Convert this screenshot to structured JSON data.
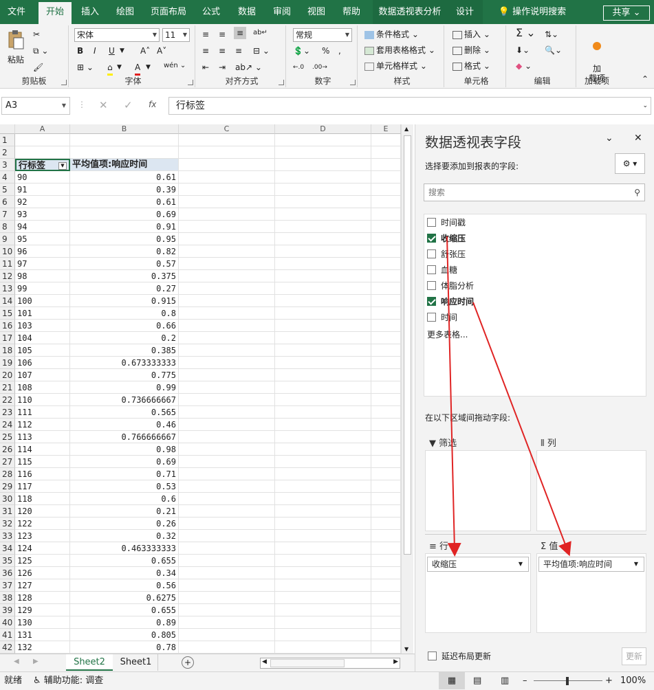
{
  "tabs": [
    "文件",
    "开始",
    "插入",
    "绘图",
    "页面布局",
    "公式",
    "数据",
    "审阅",
    "视图",
    "帮助",
    "数据透视表分析",
    "设计"
  ],
  "tell_me": "操作说明搜索",
  "share": "共享",
  "ribbon": {
    "clipboard": {
      "paste": "粘贴",
      "label": "剪贴板"
    },
    "font": {
      "name": "宋体",
      "size": "11",
      "label": "字体",
      "bold": "B",
      "italic": "I",
      "underline": "U"
    },
    "align": {
      "label": "对齐方式"
    },
    "number": {
      "format": "常规",
      "label": "数字",
      "percent": "%"
    },
    "styles": {
      "cond": "条件格式",
      "table": "套用表格格式",
      "cell": "单元格样式",
      "label": "样式"
    },
    "cells": {
      "insert": "插入",
      "delete": "删除",
      "format": "格式",
      "label": "单元格"
    },
    "editing": {
      "label": "编辑"
    },
    "addins": {
      "btn": "加\n载项",
      "label": "加载项"
    }
  },
  "formula": {
    "namebox": "A3",
    "fx": "fx",
    "content": "行标签"
  },
  "columns": [
    "A",
    "B",
    "C",
    "D",
    "E"
  ],
  "pivot": {
    "header_a": "行标签",
    "header_b": "平均值项:响应时间",
    "rows": [
      [
        "90",
        "0.61"
      ],
      [
        "91",
        "0.39"
      ],
      [
        "92",
        "0.61"
      ],
      [
        "93",
        "0.69"
      ],
      [
        "94",
        "0.91"
      ],
      [
        "95",
        "0.95"
      ],
      [
        "96",
        "0.82"
      ],
      [
        "97",
        "0.57"
      ],
      [
        "98",
        "0.375"
      ],
      [
        "99",
        "0.27"
      ],
      [
        "100",
        "0.915"
      ],
      [
        "101",
        "0.8"
      ],
      [
        "103",
        "0.66"
      ],
      [
        "104",
        "0.2"
      ],
      [
        "105",
        "0.385"
      ],
      [
        "106",
        "0.673333333"
      ],
      [
        "107",
        "0.775"
      ],
      [
        "108",
        "0.99"
      ],
      [
        "110",
        "0.736666667"
      ],
      [
        "111",
        "0.565"
      ],
      [
        "112",
        "0.46"
      ],
      [
        "113",
        "0.766666667"
      ],
      [
        "114",
        "0.98"
      ],
      [
        "115",
        "0.69"
      ],
      [
        "116",
        "0.71"
      ],
      [
        "117",
        "0.53"
      ],
      [
        "118",
        "0.6"
      ],
      [
        "120",
        "0.21"
      ],
      [
        "122",
        "0.26"
      ],
      [
        "123",
        "0.32"
      ],
      [
        "124",
        "0.463333333"
      ],
      [
        "125",
        "0.655"
      ],
      [
        "126",
        "0.34"
      ],
      [
        "127",
        "0.56"
      ],
      [
        "128",
        "0.6275"
      ],
      [
        "129",
        "0.655"
      ],
      [
        "130",
        "0.89"
      ],
      [
        "131",
        "0.805"
      ],
      [
        "132",
        "0.78"
      ]
    ]
  },
  "sheets": [
    "Sheet2",
    "Sheet1"
  ],
  "pane": {
    "title": "数据透视表字段",
    "choose": "选择要添加到报表的字段:",
    "search_placeholder": "搜索",
    "fields": [
      {
        "label": "时间戳",
        "checked": false
      },
      {
        "label": "收缩压",
        "checked": true
      },
      {
        "label": "舒张压",
        "checked": false
      },
      {
        "label": "血糖",
        "checked": false
      },
      {
        "label": "体脂分析",
        "checked": false
      },
      {
        "label": "响应时间",
        "checked": true
      },
      {
        "label": "时间",
        "checked": false
      }
    ],
    "more_tables": "更多表格...",
    "drag_hint": "在以下区域间拖动字段:",
    "filter": "筛选",
    "columns": "列",
    "rows": "行",
    "values": "值",
    "row_field": "收缩压",
    "value_field": "平均值项:响应时间",
    "defer": "延迟布局更新",
    "update": "更新"
  },
  "status": {
    "ready": "就绪",
    "accessibility": "辅助功能: 调查",
    "zoom": "100%"
  },
  "colors": {
    "accent": "#217346",
    "arrow": "#e02424"
  }
}
